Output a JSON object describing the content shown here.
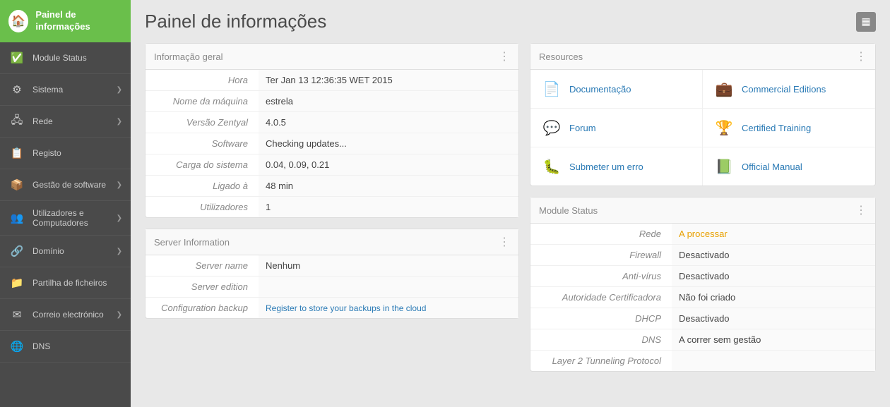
{
  "sidebar": {
    "header": {
      "title": "Painel de informações",
      "icon": "🏠"
    },
    "items": [
      {
        "id": "module-status",
        "label": "Module Status",
        "icon": "✅",
        "arrow": false
      },
      {
        "id": "sistema",
        "label": "Sistema",
        "icon": "⚙️",
        "arrow": true
      },
      {
        "id": "rede",
        "label": "Rede",
        "icon": "🖧",
        "arrow": true
      },
      {
        "id": "registo",
        "label": "Registo",
        "icon": "📋",
        "arrow": false
      },
      {
        "id": "gestao-software",
        "label": "Gestão de software",
        "icon": "📦",
        "arrow": true
      },
      {
        "id": "utilizadores",
        "label": "Utilizadores e Computadores",
        "icon": "👥",
        "arrow": true
      },
      {
        "id": "dominio",
        "label": "Domínio",
        "icon": "🔗",
        "arrow": true
      },
      {
        "id": "partilha-ficheiros",
        "label": "Partilha de ficheiros",
        "icon": "📁",
        "arrow": false
      },
      {
        "id": "correio",
        "label": "Correio electrónico",
        "icon": "✉️",
        "arrow": true
      },
      {
        "id": "dns",
        "label": "DNS",
        "icon": "🌐",
        "arrow": false
      }
    ]
  },
  "page": {
    "title": "Painel de informações",
    "grid_icon": "▦"
  },
  "info_geral": {
    "panel_title": "Informação geral",
    "fields": [
      {
        "label": "Hora",
        "value": "Ter Jan 13 12:36:35 WET 2015"
      },
      {
        "label": "Nome da máquina",
        "value": "estrela"
      },
      {
        "label": "Versão Zentyal",
        "value": "4.0.5"
      },
      {
        "label": "Software",
        "value": "Checking updates..."
      },
      {
        "label": "Carga do sistema",
        "value": "0.04, 0.09, 0.21"
      },
      {
        "label": "Ligado à",
        "value": "48 min"
      },
      {
        "label": "Utilizadores",
        "value": "1"
      }
    ]
  },
  "server_info": {
    "panel_title": "Server Information",
    "fields": [
      {
        "label": "Server name",
        "value": "Nenhum",
        "type": "text"
      },
      {
        "label": "Server edition",
        "value": "",
        "type": "text"
      },
      {
        "label": "Configuration backup",
        "value": "Register to store your backups in the cloud",
        "type": "link"
      }
    ]
  },
  "resources": {
    "panel_title": "Resources",
    "items": [
      {
        "id": "documentacao",
        "label": "Documentação",
        "icon": "📄",
        "icon_color": "#2196F3"
      },
      {
        "id": "commercial-editions",
        "label": "Commercial Editions",
        "icon": "💼",
        "icon_color": "#555"
      },
      {
        "id": "forum",
        "label": "Forum",
        "icon": "💬",
        "icon_color": "#e07020"
      },
      {
        "id": "certified-training",
        "label": "Certified Training",
        "icon": "🏆",
        "icon_color": "#e07020"
      },
      {
        "id": "submeter-erro",
        "label": "Submeter um erro",
        "icon": "🐛",
        "icon_color": "#cc2222"
      },
      {
        "id": "official-manual",
        "label": "Official Manual",
        "icon": "📗",
        "icon_color": "#4caf50"
      }
    ]
  },
  "module_status": {
    "panel_title": "Module Status",
    "items": [
      {
        "label": "Rede",
        "value": "A processar",
        "status": "processing"
      },
      {
        "label": "Firewall",
        "value": "Desactivado",
        "status": "disabled"
      },
      {
        "label": "Anti-vírus",
        "value": "Desactivado",
        "status": "disabled"
      },
      {
        "label": "Autoridade Certificadora",
        "value": "Não foi criado",
        "status": "notcreated"
      },
      {
        "label": "DHCP",
        "value": "Desactivado",
        "status": "disabled"
      },
      {
        "label": "DNS",
        "value": "A correr sem gestão",
        "status": "running"
      },
      {
        "label": "Layer 2 Tunneling Protocol",
        "value": "",
        "status": ""
      }
    ]
  }
}
